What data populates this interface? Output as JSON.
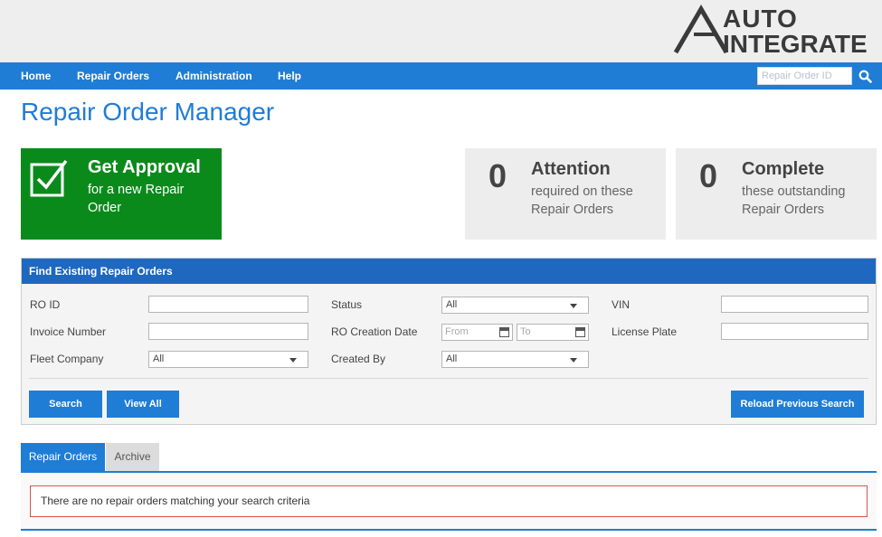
{
  "brand": {
    "logo_line1": "AUTO",
    "logo_line2": "INTEGRATE"
  },
  "nav": {
    "items": [
      {
        "label": "Home"
      },
      {
        "label": "Repair Orders"
      },
      {
        "label": "Administration"
      },
      {
        "label": "Help"
      }
    ],
    "search_placeholder": "Repair Order ID"
  },
  "page": {
    "title": "Repair Order Manager"
  },
  "cards": {
    "approval": {
      "title": "Get Approval",
      "subtitle": "for a new Repair Order"
    },
    "attention": {
      "count": "0",
      "title": "Attention",
      "subtitle": "required on these Repair Orders"
    },
    "complete": {
      "count": "0",
      "title": "Complete",
      "subtitle": "these outstanding Repair Orders"
    }
  },
  "find": {
    "header": "Find Existing Repair Orders",
    "ro_id_label": "RO ID",
    "invoice_label": "Invoice Number",
    "fleet_label": "Fleet Company",
    "fleet_value": "All",
    "status_label": "Status",
    "status_value": "All",
    "creation_date_label": "RO Creation Date",
    "date_from_placeholder": "From",
    "date_to_placeholder": "To",
    "created_by_label": "Created By",
    "created_by_value": "All",
    "vin_label": "VIN",
    "plate_label": "License Plate",
    "search_button": "Search",
    "view_all_button": "View All",
    "reload_button": "Reload Previous Search"
  },
  "tabs": [
    {
      "label": "Repair Orders",
      "active": true
    },
    {
      "label": "Archive",
      "active": false
    }
  ],
  "results": {
    "empty_message": "There are no repair orders matching your search criteria"
  },
  "colors": {
    "primary": "#1f7dd6",
    "header_dark": "#1f68c0",
    "approval_green": "#0b8a1c",
    "alert_border": "#d9534f"
  }
}
